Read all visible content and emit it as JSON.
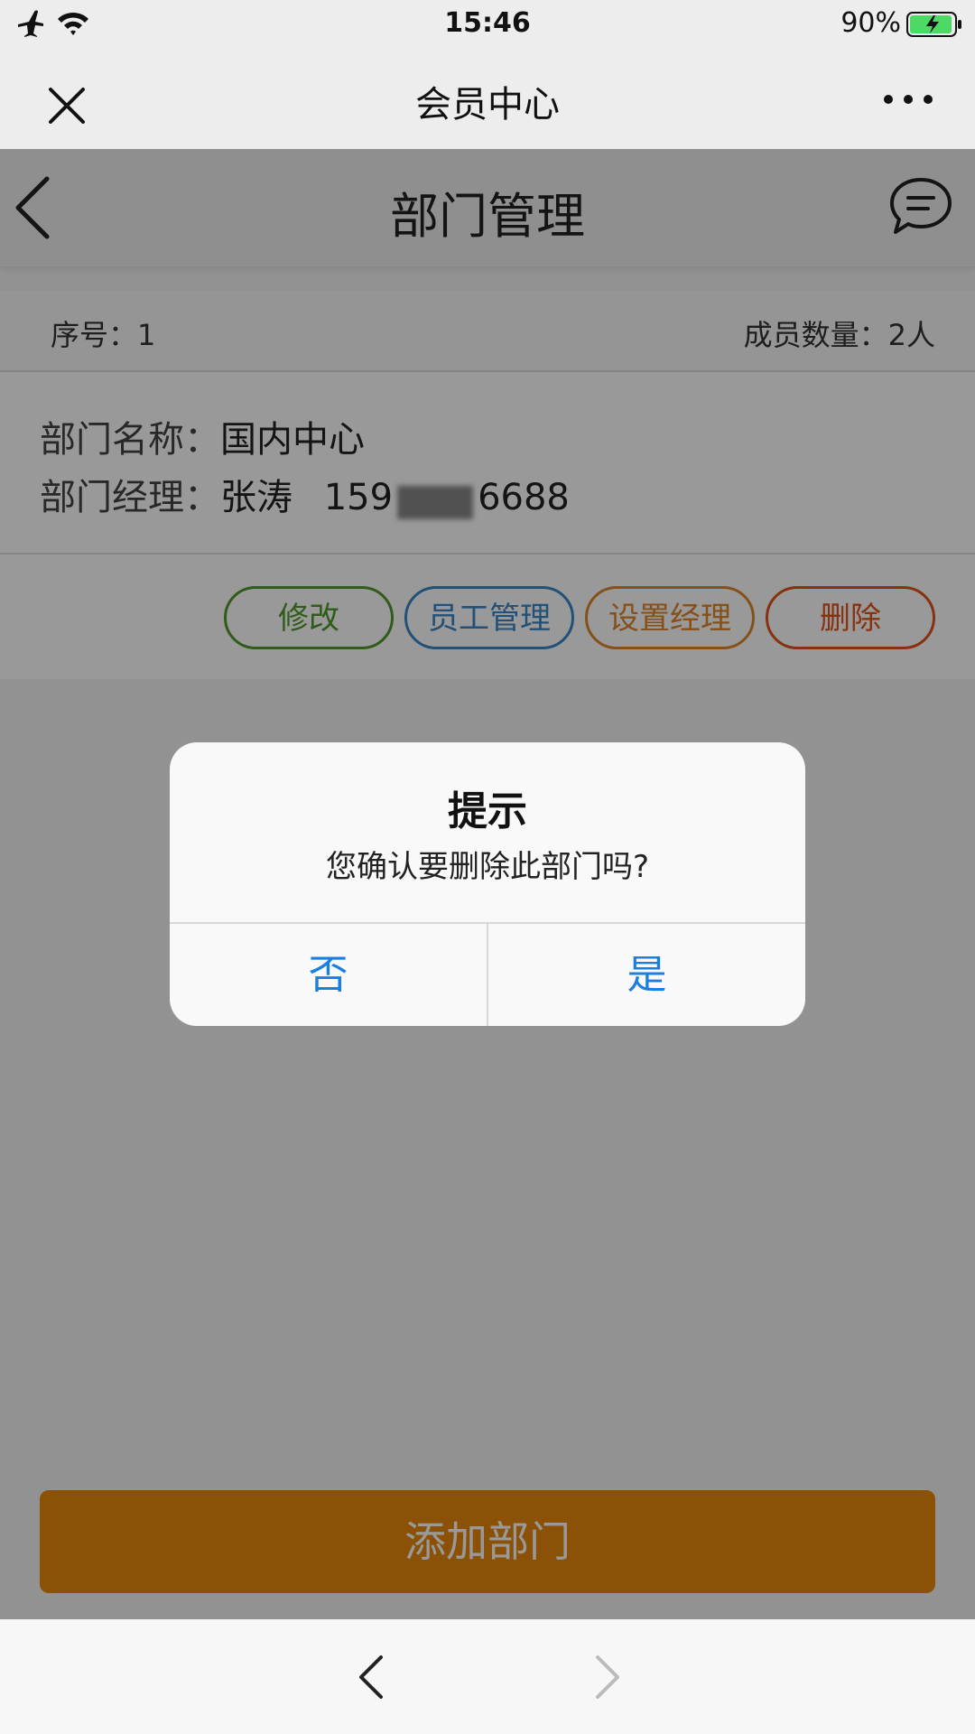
{
  "status_bar": {
    "time": "15:46",
    "battery_percent": "90%",
    "icons": [
      "airplane-icon",
      "wifi-icon",
      "battery-icon"
    ]
  },
  "wechat_bar": {
    "title": "会员中心",
    "icons": [
      "close-icon",
      "more-icon"
    ]
  },
  "page_header": {
    "title": "部门管理",
    "icons": [
      "back-chevron-icon",
      "message-icon"
    ]
  },
  "department": {
    "seq_label": "序号：",
    "seq_value": "1",
    "count_label": "成员数量：",
    "count_value": "2人",
    "name_label": "部门名称：",
    "name_value": "国内中心",
    "manager_label": "部门经理：",
    "manager_name": "张涛",
    "phone_prefix": "159",
    "phone_suffix": "6688"
  },
  "actions": {
    "edit": "修改",
    "staff": "员工管理",
    "set_manager": "设置经理",
    "delete": "删除"
  },
  "add_button": "添加部门",
  "dialog": {
    "title": "提示",
    "message": "您确认要删除此部门吗?",
    "no": "否",
    "yes": "是"
  },
  "colors": {
    "edit": "#4f9a2a",
    "staff": "#3a86c6",
    "set_manager": "#e0852a",
    "delete": "#e0521a",
    "add_button": "#e8890c",
    "dialog_button": "#1a7fe0"
  }
}
